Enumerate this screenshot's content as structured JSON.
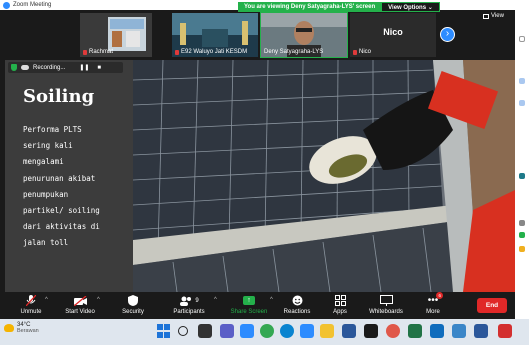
{
  "window": {
    "title": "Zoom Meeting"
  },
  "banner": {
    "viewing_text": "You are viewing Deny Satyagraha-LYS' screen",
    "view_options_label": "View Options ⌄"
  },
  "participants": [
    {
      "name": "Rachmat"
    },
    {
      "name": "E92 Waluyo Jati KESDM"
    },
    {
      "name": "Deny Satyagraha-LYS"
    },
    {
      "name": "Nico",
      "big_name": "Nico"
    }
  ],
  "view_label": "View",
  "recording": {
    "label": "Recording...",
    "pause": "❚❚",
    "stop": "■"
  },
  "slide": {
    "title": "Soiling",
    "body_lines": [
      "Performa PLTS",
      "sering kali",
      "mengalami",
      "penurunan akibat",
      "penumpukan",
      "partikel/ soiling",
      "dari aktivitas di",
      "jalan toll"
    ]
  },
  "toolbar": {
    "unmute": "Unmute",
    "start_video": "Start Video",
    "security": "Security",
    "participants": "Participants",
    "participants_count": "9",
    "share_screen": "Share Screen",
    "reactions": "Reactions",
    "apps": "Apps",
    "whiteboards": "Whiteboards",
    "more": "More",
    "more_badge": "6",
    "end": "End"
  },
  "taskbar": {
    "temp": "34°C",
    "weather": "Berawan"
  },
  "colors": {
    "green": "#24b14b",
    "red": "#e02828",
    "blue": "#2d8cff"
  }
}
